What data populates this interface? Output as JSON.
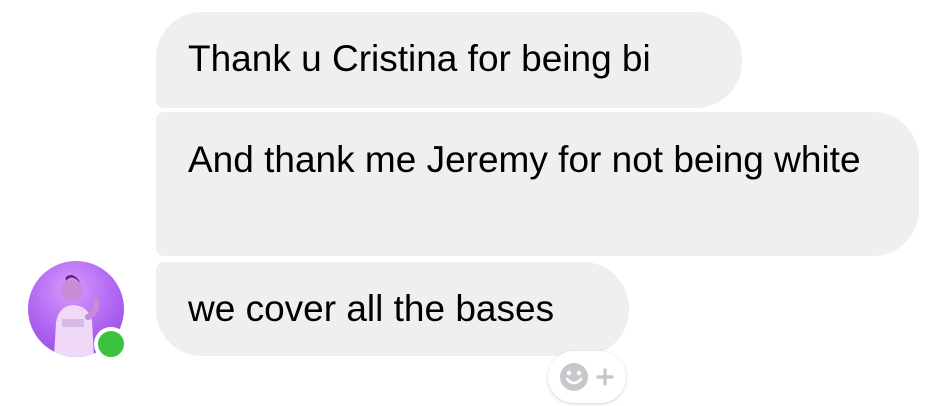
{
  "conversation": {
    "messages": [
      {
        "text": "Thank u Cristina for being bi"
      },
      {
        "text": "And thank me Jeremy for not being white"
      },
      {
        "text": "we cover all the bases"
      }
    ],
    "sender": {
      "online": true,
      "status_color": "#3bc340"
    },
    "reaction_button": {
      "icon": "smiley-plus-icon"
    }
  },
  "colors": {
    "bubble_bg": "#efefef",
    "text": "#000000",
    "background": "#ffffff"
  }
}
